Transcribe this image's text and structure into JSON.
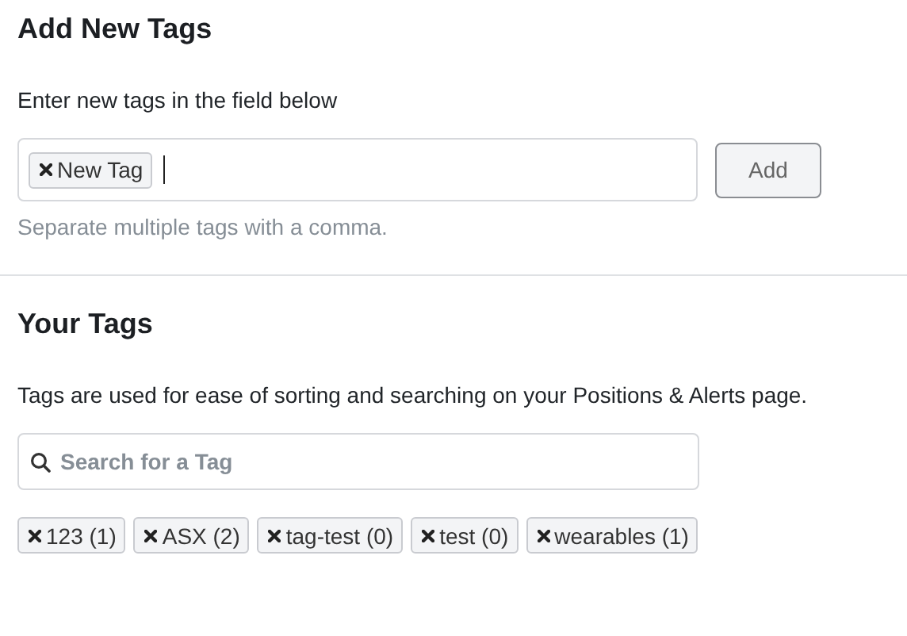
{
  "add_section": {
    "title": "Add New Tags",
    "instruction": "Enter new tags in the field below",
    "tag_input": {
      "tags": [
        {
          "label": "New Tag"
        }
      ],
      "focused": true
    },
    "add_button": "Add",
    "hint": "Separate multiple tags with a comma."
  },
  "tags_section": {
    "title": "Your Tags",
    "description": "Tags are used for ease of sorting and searching on your Positions & Alerts page.",
    "search": {
      "placeholder": "Search for a Tag"
    },
    "tags": [
      {
        "label": "123 (1)"
      },
      {
        "label": "ASX (2)"
      },
      {
        "label": "tag-test (0)"
      },
      {
        "label": "test (0)"
      },
      {
        "label": "wearables (1)"
      }
    ]
  }
}
